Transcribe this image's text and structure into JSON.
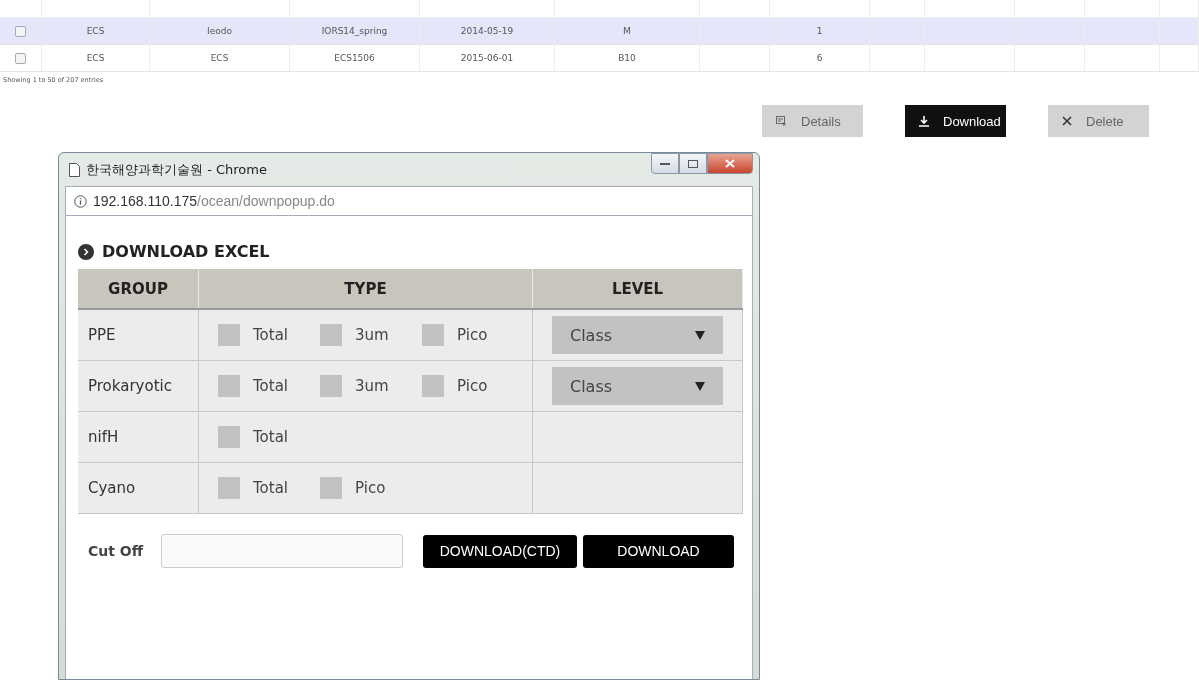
{
  "table": {
    "rows": [
      {
        "selected": true,
        "checked": false,
        "cells": [
          "ECS",
          "Ieodo",
          "IORS14_spring",
          "2014-05-19",
          "M",
          "",
          "1"
        ]
      },
      {
        "selected": false,
        "checked": false,
        "cells": [
          "ECS",
          "ECS",
          "ECS1506",
          "2015-06-01",
          "B10",
          "",
          "6"
        ]
      }
    ],
    "info": "Showing 1 to 50 of 207 entries"
  },
  "actions": [
    {
      "kind": "details",
      "label": "Details"
    },
    {
      "kind": "download",
      "label": "Download"
    },
    {
      "kind": "delete",
      "label": "Delete"
    }
  ],
  "popup": {
    "title": "한국해양과학기술원 - Chrome",
    "url_host": "192.168.110.175",
    "url_path": "/ocean/downpopup.do",
    "heading": "DOWNLOAD EXCEL",
    "columns": [
      "GROUP",
      "TYPE",
      "LEVEL"
    ],
    "rows": [
      {
        "group": "PPE",
        "types": [
          {
            "label": "Total",
            "checked": false
          },
          {
            "label": "3um",
            "checked": false
          },
          {
            "label": "Pico",
            "checked": false
          }
        ],
        "level": "Class"
      },
      {
        "group": "Prokaryotic",
        "types": [
          {
            "label": "Total",
            "checked": false
          },
          {
            "label": "3um",
            "checked": false
          },
          {
            "label": "Pico",
            "checked": false
          }
        ],
        "level": "Class"
      },
      {
        "group": "nifH",
        "types": [
          {
            "label": "Total",
            "checked": false
          }
        ]
      },
      {
        "group": "Cyano",
        "types": [
          {
            "label": "Total",
            "checked": false
          },
          {
            "label": "Pico",
            "checked": false
          }
        ]
      }
    ],
    "cutoff_label": "Cut Off",
    "buttons": [
      "DOWNLOAD(CTD)",
      "DOWNLOAD"
    ]
  }
}
